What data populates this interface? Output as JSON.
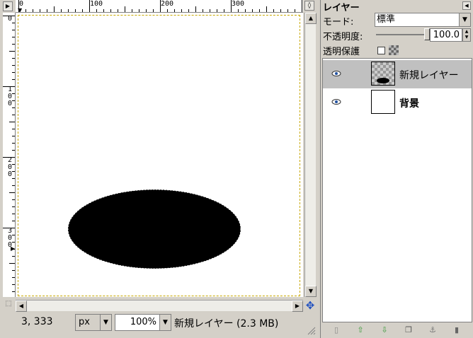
{
  "status": {
    "coords": "3, 333",
    "unit": "px",
    "zoom": "100%",
    "info": "新規レイヤー (2.3 MB)"
  },
  "rulers": {
    "h_labels": [
      "0",
      "100",
      "200",
      "300"
    ],
    "v_labels": [
      "0",
      "100",
      "200",
      "300"
    ]
  },
  "layers": {
    "title": "レイヤー",
    "mode_label": "モード:",
    "mode_value": "標準",
    "opacity_label": "不透明度:",
    "opacity_value": "100.0",
    "lock_label": "透明保護",
    "items": [
      {
        "name": "新規レイヤー",
        "active": true
      },
      {
        "name": "背景",
        "active": false
      }
    ]
  },
  "icons": {
    "eye": "eye-icon",
    "new_layer": "new-layer-icon",
    "raise": "raise-layer-icon",
    "lower": "lower-layer-icon",
    "duplicate": "duplicate-layer-icon",
    "anchor": "anchor-icon",
    "delete": "trash-icon",
    "navigate": "navigate-icon"
  },
  "colors": {
    "selection_border": "#c8a800",
    "active_layer": "#c0c0c0",
    "nav_icon": "#2050c0"
  }
}
